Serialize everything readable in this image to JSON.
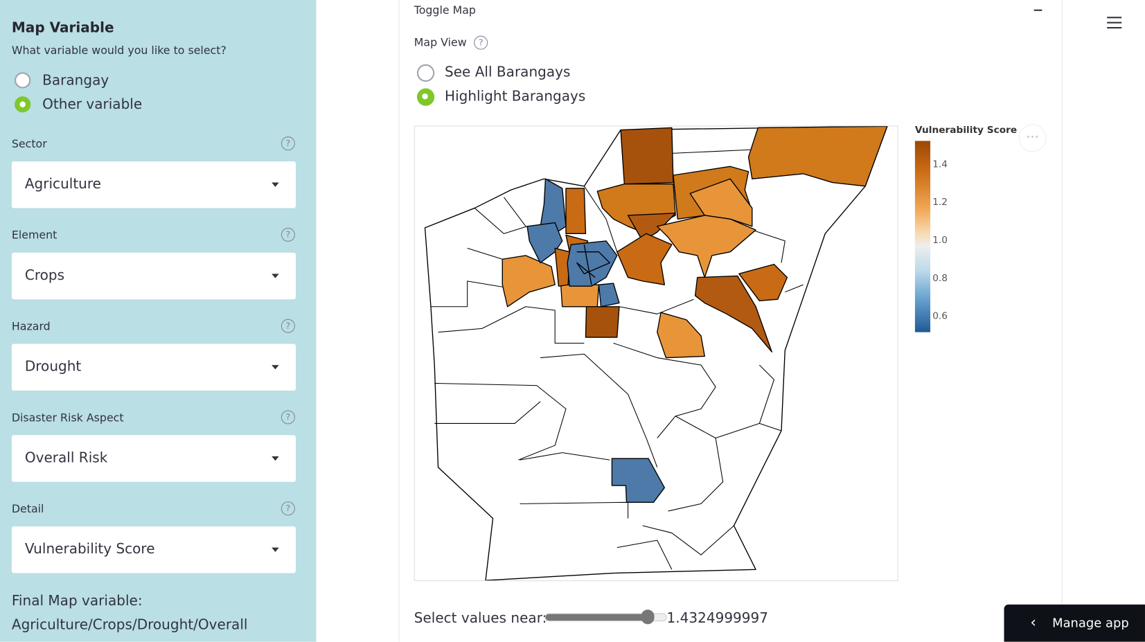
{
  "sidebar": {
    "title": "Map Variable",
    "question": "What variable would you like to select?",
    "radio_options": [
      {
        "label": "Barangay",
        "selected": false
      },
      {
        "label": "Other variable",
        "selected": true
      }
    ],
    "selects": [
      {
        "label": "Sector",
        "value": "Agriculture"
      },
      {
        "label": "Element",
        "value": "Crops"
      },
      {
        "label": "Hazard",
        "value": "Drought"
      },
      {
        "label": "Disaster Risk Aspect",
        "value": "Overall Risk"
      },
      {
        "label": "Detail",
        "value": "Vulnerability Score"
      }
    ],
    "final_label": "Final Map variable:",
    "final_value": "Agriculture/Crops/Drought/Overall"
  },
  "main": {
    "toggle_label": "Toggle Map",
    "collapse_icon": "minus-icon",
    "map_view_label": "Map View",
    "map_view_options": [
      {
        "label": "See All Barangays",
        "selected": false
      },
      {
        "label": "Highlight Barangays",
        "selected": true
      }
    ],
    "legend": {
      "title": "Vulnerability Score",
      "ticks": [
        "1.4",
        "1.2",
        "1.0",
        "0.8",
        "0.6"
      ],
      "range": [
        0.55,
        1.52
      ],
      "colors": {
        "high": "#a6520c",
        "mid": "#f2f0ea",
        "low": "#1f5a96"
      }
    },
    "slider": {
      "label": "Select values near:",
      "value": "1.4324999997",
      "fraction": 0.87
    },
    "menu_icon": "hamburger-icon"
  },
  "manage_app": {
    "label": "Manage app",
    "icon": "chevron-left-icon"
  },
  "help_glyph": "?",
  "more_glyph": "•••"
}
